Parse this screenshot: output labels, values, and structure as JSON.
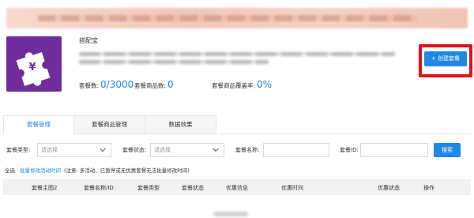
{
  "app": {
    "name": "搭配宝",
    "icon": "puzzle-yen-icon",
    "icon_color": "#6f2d9c"
  },
  "header": {
    "create_button_label": "+ 创建套餐"
  },
  "stats": [
    {
      "label": "套餐数:",
      "value": "0/3000"
    },
    {
      "label": "套餐商品数:",
      "value": "0"
    },
    {
      "label": "套餐商品覆盖率:",
      "value": "0%"
    }
  ],
  "tabs": [
    {
      "label": "套餐管理",
      "active": true
    },
    {
      "label": "套餐商品管理",
      "active": false
    },
    {
      "label": "数据效果",
      "active": false
    }
  ],
  "filters": {
    "type_label": "套餐类型:",
    "type_placeholder": "请选择",
    "status_label": "套餐状态:",
    "status_placeholder": "请选择",
    "name_label": "套餐名称:",
    "id_label": "套餐ID:",
    "search_button": "搜索"
  },
  "batch": {
    "select_all": "全选",
    "link": "批量修改活动时间",
    "note": "(注意: 多活动、已暂停或无优惠套餐无法批量修改时间)"
  },
  "table": {
    "columns": [
      "套餐主图2",
      "套餐名称/ID",
      "套餐类型",
      "套餐状态",
      "优惠信息",
      "优惠时间",
      "优惠状态",
      "操作"
    ]
  },
  "colors": {
    "accent": "#1e88e5",
    "highlight": "#e2131b"
  }
}
